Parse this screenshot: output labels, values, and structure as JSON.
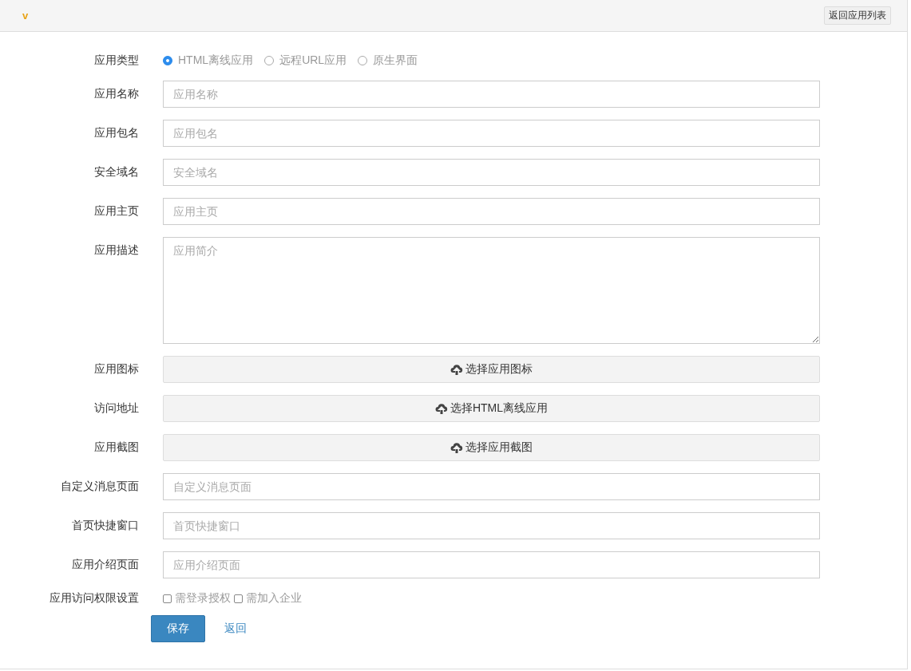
{
  "header": {
    "title": "v",
    "back_button": "返回应用列表"
  },
  "rows": [
    {
      "kind": "radio",
      "label": "应用类型",
      "options": [
        {
          "label": "HTML离线应用",
          "selected": true
        },
        {
          "label": "远程URL应用",
          "selected": false
        },
        {
          "label": "原生界面",
          "selected": false
        }
      ]
    },
    {
      "kind": "input",
      "label": "应用名称",
      "placeholder": "应用名称"
    },
    {
      "kind": "input",
      "label": "应用包名",
      "placeholder": "应用包名"
    },
    {
      "kind": "input",
      "label": "安全域名",
      "placeholder": "安全域名"
    },
    {
      "kind": "input",
      "label": "应用主页",
      "placeholder": "应用主页"
    },
    {
      "kind": "textarea",
      "label": "应用描述",
      "placeholder": "应用简介"
    },
    {
      "kind": "upload",
      "label": "应用图标",
      "button": "选择应用图标"
    },
    {
      "kind": "upload",
      "label": "访问地址",
      "button": "选择HTML离线应用"
    },
    {
      "kind": "upload",
      "label": "应用截图",
      "button": "选择应用截图"
    },
    {
      "kind": "input",
      "label": "自定义消息页面",
      "placeholder": "自定义消息页面"
    },
    {
      "kind": "input",
      "label": "首页快捷窗口",
      "placeholder": "首页快捷窗口"
    },
    {
      "kind": "input",
      "label": "应用介绍页面",
      "placeholder": "应用介绍页面"
    },
    {
      "kind": "checkbox",
      "label": "应用访问权限设置",
      "options": [
        {
          "label": "需登录授权",
          "checked": false
        },
        {
          "label": "需加入企业",
          "checked": false
        }
      ]
    }
  ],
  "actions": {
    "save": "保存",
    "back": "返回"
  }
}
